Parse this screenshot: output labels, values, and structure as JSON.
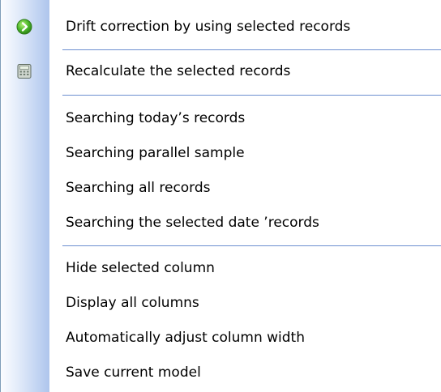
{
  "menu": {
    "items": [
      {
        "label": "Drift correction by using selected records",
        "icon": "green-arrow-icon"
      },
      {
        "label": "Recalculate the selected records",
        "icon": "calculator-icon"
      },
      {
        "label": "Searching today’s records"
      },
      {
        "label": "Searching parallel sample"
      },
      {
        "label": "Searching all records"
      },
      {
        "label": "Searching the selected date ’records"
      },
      {
        "label": "Hide selected column"
      },
      {
        "label": "Display all columns"
      },
      {
        "label": "Automatically adjust column width"
      },
      {
        "label": "Save current model"
      }
    ]
  },
  "colors": {
    "separator": "#6d8fd0",
    "gutter": "#c2d4f2",
    "icon_green": "#3aa51f"
  }
}
